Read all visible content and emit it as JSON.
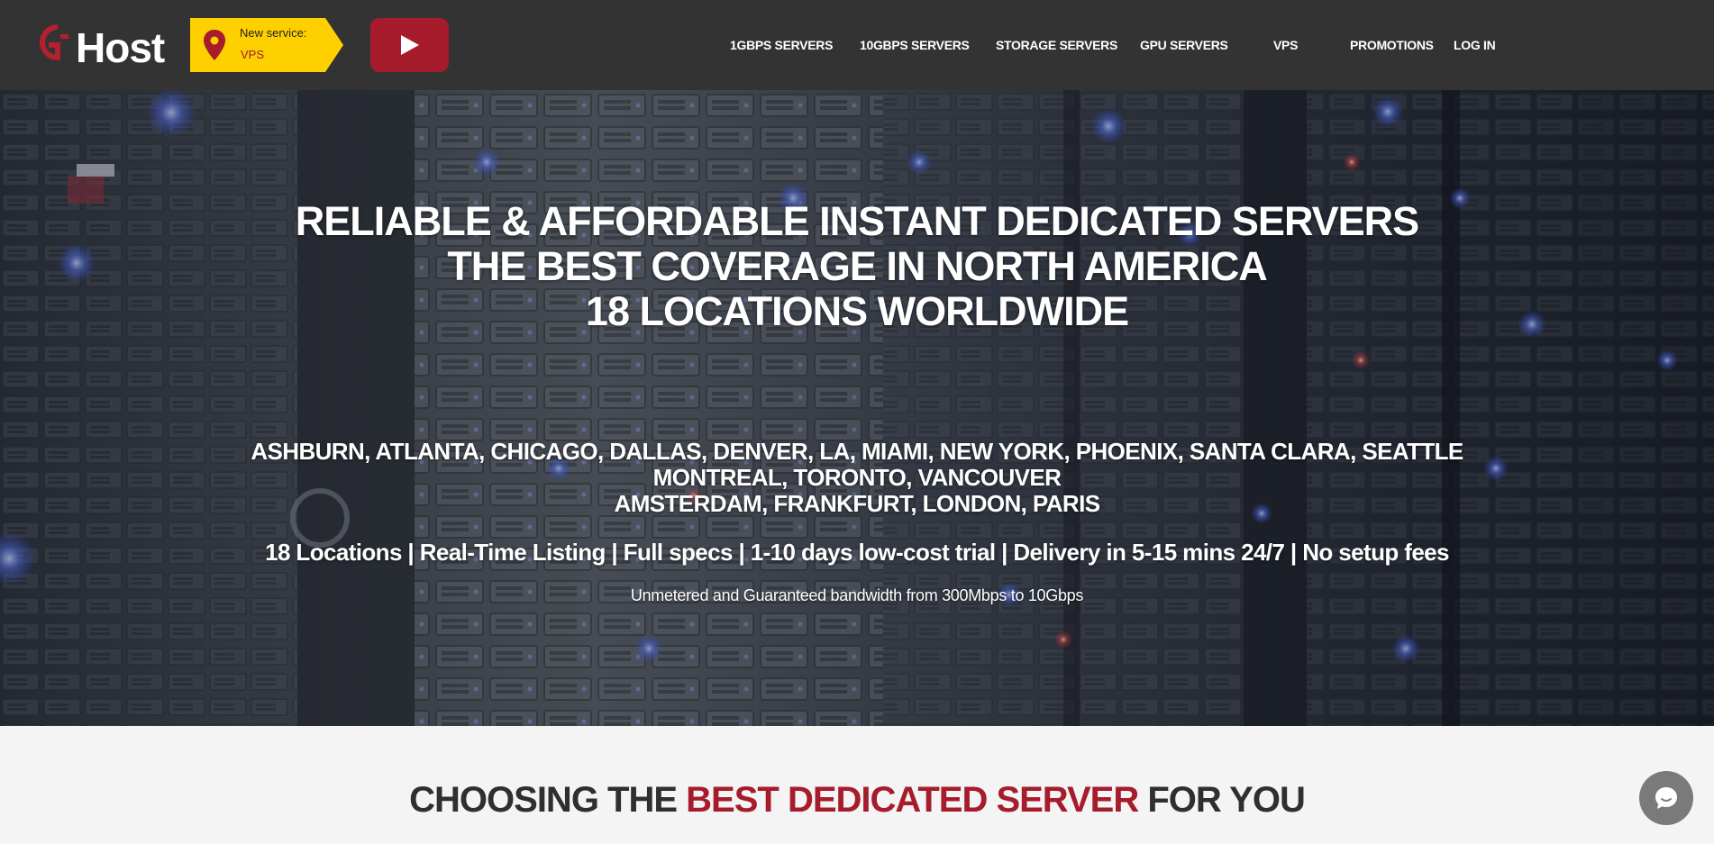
{
  "brand": {
    "logo_text": "Host",
    "logo_mark": "G"
  },
  "new_service": {
    "label": "New service:",
    "value": "VPS",
    "icon": "location-pin-icon"
  },
  "video_button": {
    "icon": "play-icon"
  },
  "nav": {
    "items": [
      {
        "label": "1GBPS SERVERS"
      },
      {
        "label": "10GBPS SERVERS"
      },
      {
        "label": "STORAGE SERVERS"
      },
      {
        "label": "GPU SERVERS"
      },
      {
        "label": "VPS"
      },
      {
        "label": "PROMOTIONS"
      },
      {
        "label": "LOG IN"
      }
    ]
  },
  "hero": {
    "title_lines": [
      "RELIABLE & AFFORDABLE INSTANT DEDICATED SERVERS",
      "THE BEST COVERAGE IN NORTH AMERICA",
      "18 LOCATIONS WORLDWIDE"
    ],
    "city_lines": [
      "ASHBURN, ATLANTA, CHICAGO, DALLAS, DENVER, LA, MIAMI, NEW YORK, PHOENIX, SANTA CLARA, SEATTLE",
      "MONTREAL, TORONTO, VANCOUVER",
      "AMSTERDAM, FRANKFURT, LONDON, PARIS"
    ],
    "features": "18 Locations | Real-Time Listing | Full specs | 1-10 days low-cost trial | Delivery in 5-15 mins 24/7 | No setup fees",
    "bandwidth": "Unmetered and Guaranteed bandwidth from 300Mbps to 10Gbps"
  },
  "section": {
    "heading_prefix": "CHOOSING THE ",
    "heading_accent": "BEST DEDICATED SERVER",
    "heading_suffix": " FOR YOU"
  },
  "chat": {
    "icon": "chat-bubble-icon"
  },
  "colors": {
    "header_bg": "#333333",
    "accent_red": "#a61c2d",
    "banner_yellow": "#ffd000",
    "text_white": "#ffffff",
    "page_bg": "#f4f4f4"
  }
}
